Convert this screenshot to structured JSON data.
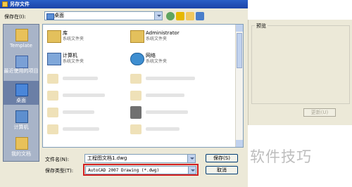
{
  "window": {
    "title": "另存文件"
  },
  "toolbar": {
    "save_in_label": "保存在(I):",
    "location": "桌面"
  },
  "places": [
    {
      "label": "Template"
    },
    {
      "label": "最近使用的项目"
    },
    {
      "label": "桌面"
    },
    {
      "label": "计算机"
    },
    {
      "label": "我的文档"
    }
  ],
  "files": [
    {
      "name": "库",
      "subtitle": "系统文件夹"
    },
    {
      "name": "Administrator",
      "subtitle": "系统文件夹"
    },
    {
      "name": "计算机",
      "subtitle": "系统文件夹"
    },
    {
      "name": "网络",
      "subtitle": "系统文件夹"
    }
  ],
  "form": {
    "filename_label": "文件名(N):",
    "filename_value": "工程图文档1.dwg",
    "filetype_label": "保存类型(T):",
    "filetype_value": "AutoCAD 2007 Drawing (*.dwg)",
    "save_button": "保存(S)",
    "cancel_button": "取消"
  },
  "preview": {
    "label": "预览",
    "update_button": "更新(U)"
  },
  "watermark": "软件技巧",
  "colors": {
    "title_bar": "#1c44a8",
    "highlight": "#d21f1f",
    "places_bg": "#a8b4c8"
  }
}
